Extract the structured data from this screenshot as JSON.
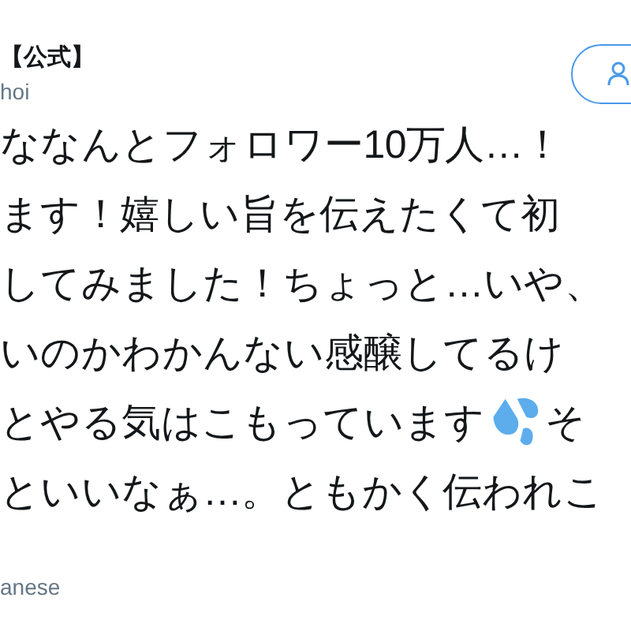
{
  "author": {
    "name": "【公式】",
    "handle": "hoi"
  },
  "follow_button": {
    "kind": "person"
  },
  "tweet": {
    "lines": [
      [
        {
          "kind": "text",
          "text": "ななんとフォロワー10万人…！"
        }
      ],
      [
        {
          "kind": "text",
          "text": "ます！嬉しい旨を伝えたくて初"
        }
      ],
      [
        {
          "kind": "text",
          "text": "してみました！ちょっと…いや、"
        }
      ],
      [
        {
          "kind": "text",
          "text": "いのかわかんない感醸してるけ"
        }
      ],
      [
        {
          "kind": "text",
          "text": "とやる気はこもっています"
        },
        {
          "kind": "emoji"
        },
        {
          "kind": "text",
          "text": "そ"
        }
      ],
      [
        {
          "kind": "text",
          "text": "といいなぁ…。ともかく伝われこ"
        }
      ]
    ]
  },
  "translate_link": "anese"
}
